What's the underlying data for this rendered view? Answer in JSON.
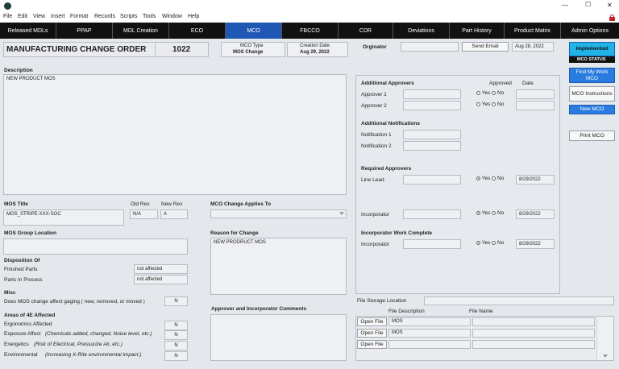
{
  "window": {
    "minimize": "—",
    "maximize": "☐",
    "close": "✕"
  },
  "menu": [
    "File",
    "Edit",
    "View",
    "Insert",
    "Format",
    "Records",
    "Scripts",
    "Tools",
    "Window",
    "Help"
  ],
  "tabs": [
    "Released MDLs",
    "PPAP",
    "MDL Creation",
    "ECO",
    "MCO",
    "FBCCO",
    "CDR",
    "Deviations",
    "Part History",
    "Product Matrix",
    "Admin Options"
  ],
  "header": {
    "title": "MANUFACTURING CHANGE ORDER",
    "number": "1022",
    "mco_type_label": "MCO Type",
    "mco_type": "MOS Change",
    "creation_label": "Creation Date",
    "creation_date": "Aug 29, 2022",
    "originator_label": "Orginator",
    "originator": "",
    "send_email": "Send Email",
    "email_date": "Aug 28, 2022"
  },
  "right_panel": {
    "status": "Implemented",
    "status_label": "MCO STATUS",
    "find_work": "Find My Work MCO",
    "instructions": "MCO Instructions",
    "new_mco": "New MCO",
    "print": "Print MCO"
  },
  "description": {
    "label": "Description",
    "value": "NEW PRODUCT MOS"
  },
  "mos": {
    "title_label": "MOS Title",
    "title": "MOS_STRIPE-XXX-SOC",
    "old_rev_label": "Old Rev",
    "old_rev": "N/A",
    "new_rev_label": "New Rev",
    "new_rev": "A",
    "group_label": "MOS Group Location",
    "group": ""
  },
  "applies": {
    "label": "MCO Change Applies To",
    "value": ""
  },
  "reason": {
    "label": "Reason for Change",
    "value": "NEW PRODRUCT MOS"
  },
  "disposition": {
    "label": "Disposition Of",
    "finished_label": "Finished Parts",
    "finished": "not affected",
    "wip_label": "Parts In Process",
    "wip": "not affected"
  },
  "misc": {
    "label": "Misc",
    "q": "Does MOS change affect gaging ( new, removed, or moved )",
    "a": "N"
  },
  "areas": {
    "label": "Areas of 4E Affected",
    "items": [
      {
        "label": "Ergonomics Affected",
        "note": "",
        "value": "N"
      },
      {
        "label": "Exposure Affect",
        "note": "(Chemicals added, changed, Noise level, etc.)",
        "value": "N"
      },
      {
        "label": "Energetics",
        "note": "(Risk of Electrical, Pressurize Air, etc.)",
        "value": "N"
      },
      {
        "label": "Environmental",
        "note": "(Increasing X-Rite environmental impact.)",
        "value": "N"
      }
    ]
  },
  "comments": {
    "label": "Approver and Incorporator Comments",
    "value": ""
  },
  "approvals": {
    "additional_label": "Additional Approvers",
    "approved_label": "Approved",
    "date_label": "Date",
    "approver1": "Approver 1",
    "approver2": "Approver 2",
    "notifications_label": "Additional Notifications",
    "notif1": "Notification 1",
    "notif2": "Notification 2",
    "required_label": "Required Approvers",
    "line_lead": "Line Lead",
    "line_lead_date": "8/29/2022",
    "incorporator": "Incorporator",
    "incorporator_date": "8/29/2022",
    "work_label": "Incorporator Work Complete",
    "work_incorporator": "Incorporator",
    "work_date": "8/29/2022",
    "yes": "Yes",
    "no": "No"
  },
  "files": {
    "storage_label": "File Storage Location",
    "desc_label": "File Description",
    "name_label": "File Name",
    "open": "Open File",
    "rows": [
      {
        "desc": "MOS",
        "name": ""
      },
      {
        "desc": "MOS",
        "name": ""
      },
      {
        "desc": "",
        "name": ""
      }
    ]
  }
}
